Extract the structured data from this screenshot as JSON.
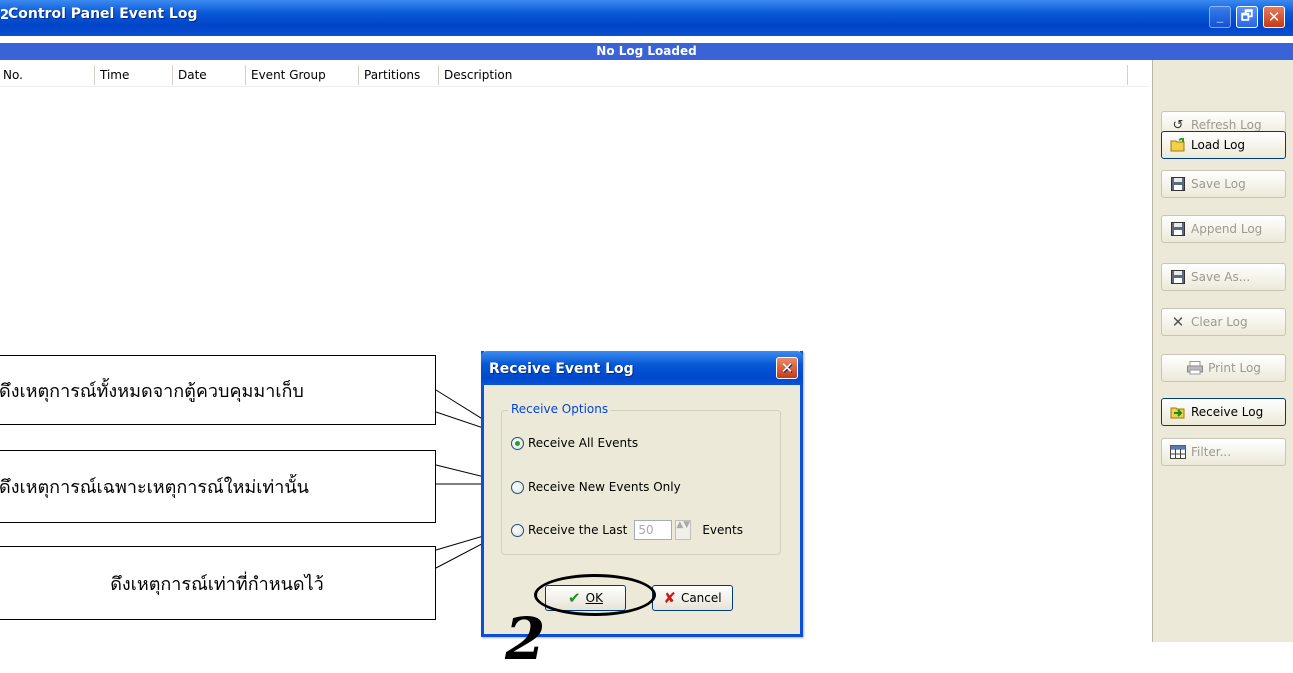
{
  "window": {
    "icon": "2",
    "title": "Control Panel Event Log",
    "controls": {
      "minimize": "_",
      "restore": "🗗",
      "close": "✕"
    }
  },
  "log_status": "No Log Loaded",
  "columns": [
    "No.",
    "Time",
    "Date",
    "Event Group",
    "Partitions",
    "Description"
  ],
  "side_buttons": [
    {
      "label": "Refresh Log",
      "icon": "refresh-icon",
      "enabled": false
    },
    {
      "label": "Load Log",
      "icon": "folder-open-icon",
      "enabled": true
    },
    {
      "label": "Save Log",
      "icon": "floppy-disk-icon",
      "enabled": false
    },
    {
      "label": "Append Log",
      "icon": "floppy-disk-icon",
      "enabled": false
    },
    {
      "label": "Save As...",
      "icon": "floppy-disk-icon",
      "enabled": false
    },
    {
      "label": "Clear Log",
      "icon": "x-icon",
      "enabled": false
    },
    {
      "label": "Print Log",
      "icon": "printer-icon",
      "enabled": false
    },
    {
      "label": "Receive Log",
      "icon": "receive-icon",
      "enabled": true
    },
    {
      "label": "Filter...",
      "icon": "filter-grid-icon",
      "enabled": false
    }
  ],
  "callouts": [
    "ดึงเหตุการณ์ทั้งหมดจากตู้ควบคุมมาเก็บ",
    "ดึงเหตุการณ์เฉพาะเหตุการณ์ใหม่เท่านั้น",
    "ดึงเหตุการณ์เท่าที่กำหนดไว้"
  ],
  "dialog": {
    "title": "Receive Event Log",
    "close": "✕",
    "group_title": "Receive Options",
    "options": [
      {
        "label": "Receive All Events",
        "checked": true
      },
      {
        "label": "Receive New Events Only",
        "checked": false
      },
      {
        "label": "Receive the Last",
        "checked": false
      }
    ],
    "last_count": "50",
    "last_suffix": "Events",
    "spin": "▲▼",
    "ok_label": "OK",
    "cancel_label": "Cancel",
    "ok_icon": "✔",
    "cancel_icon": "✘"
  },
  "step_number": "2"
}
